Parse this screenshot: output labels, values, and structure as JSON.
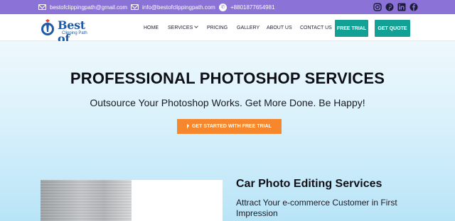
{
  "topbar": {
    "email_1": "bestofclippingpath@gmail.com",
    "email_2": "info@bestofclippingpath.com",
    "phone": "+8801877654981",
    "social_icons": [
      "instagram-icon",
      "pinterest-icon",
      "linkedin-icon",
      "facebook-icon"
    ]
  },
  "logo": {
    "line_1": "Best of",
    "line_2": "Clipping Path"
  },
  "nav": {
    "home": "HOME",
    "services": "SERVICES",
    "pricing": "PRICING",
    "gallery": "GALLERY",
    "about": "ABOUT US",
    "contact": "CONTACT US",
    "free_trial": "FREE TRIAL",
    "get_quote": "GET QUOTE"
  },
  "hero": {
    "title": "PROFESSIONAL PHOTOSHOP SERVICES",
    "subtitle": "Outsource Your Photoshop Works. Get More Done. Be Happy!",
    "cta_label": "GET STARTED WITH FREE TRIAL"
  },
  "section": {
    "title": "Car Photo Editing Services",
    "subtitle": "Attract Your e-commerce Customer in First Impression"
  },
  "colors": {
    "topbar": "#8a72d6",
    "accent_teal": "#14a195",
    "cta_orange": "#f7872c",
    "brand_blue": "#1f5aa8"
  }
}
